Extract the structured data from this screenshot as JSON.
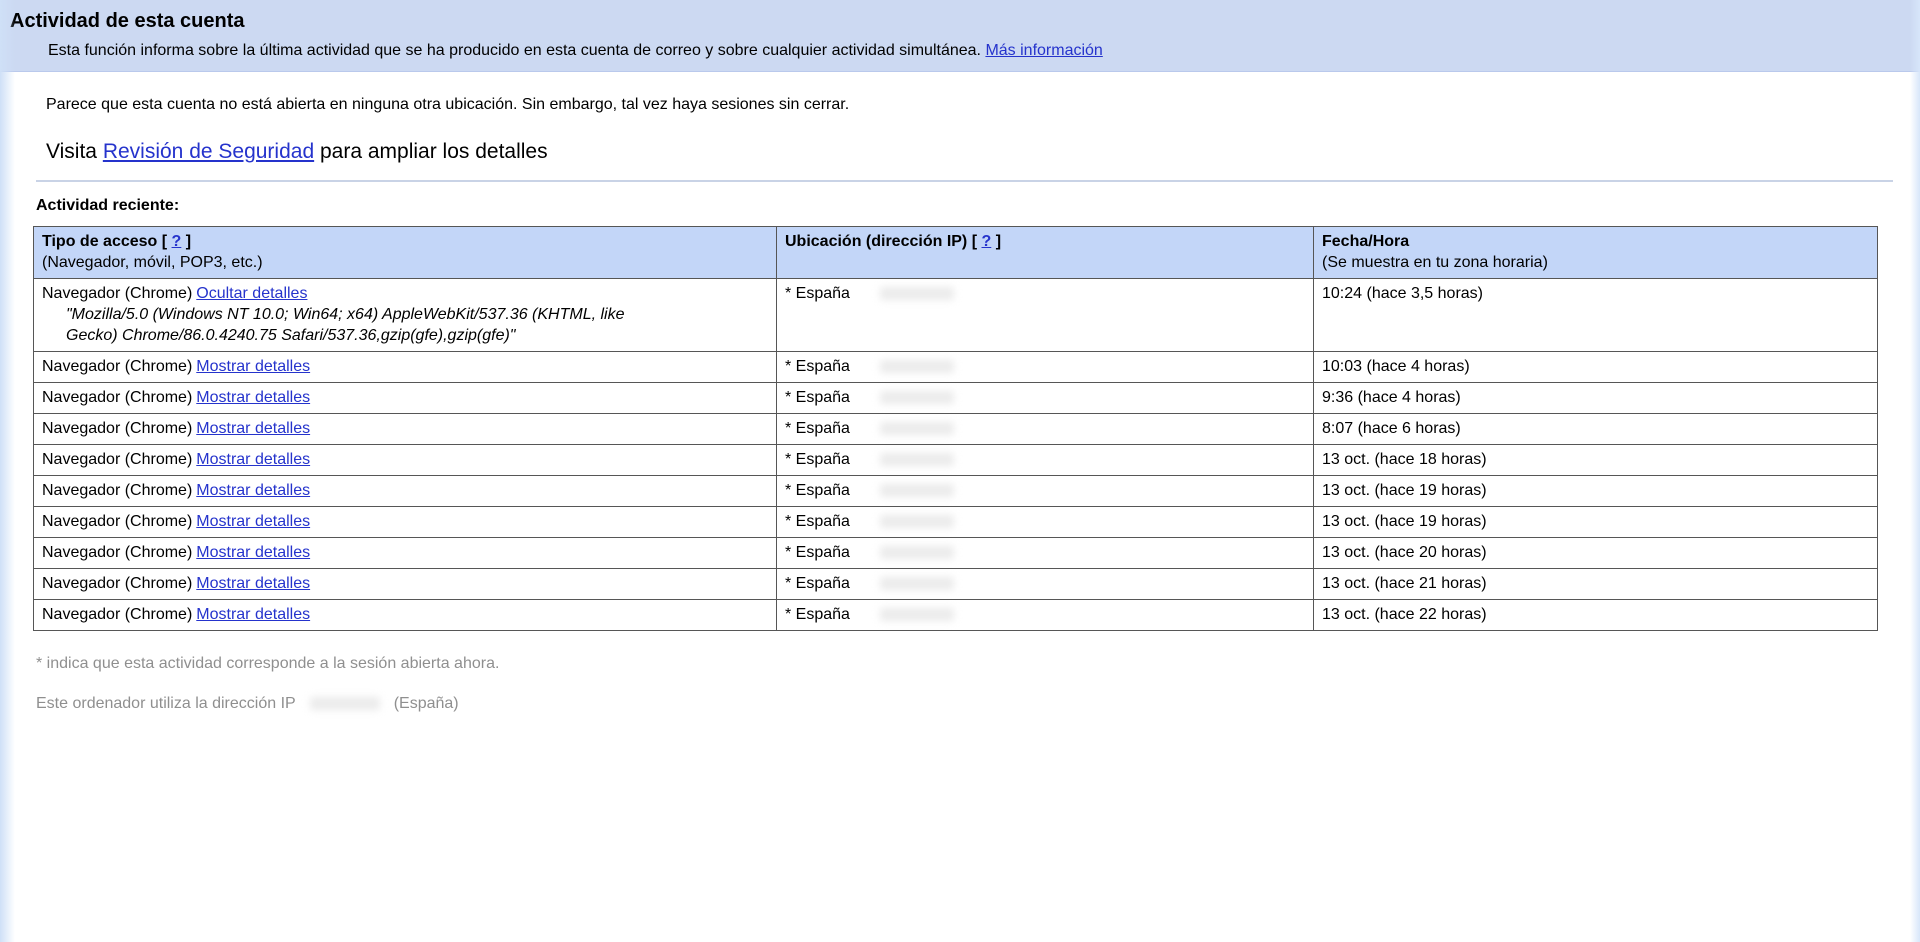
{
  "header": {
    "title": "Actividad de esta cuenta",
    "description": "Esta función informa sobre la última actividad que se ha producido en esta cuenta de correo y sobre cualquier actividad simultánea.",
    "more_info_label": "Más información"
  },
  "status_message": "Parece que esta cuenta no está abierta en ninguna otra ubicación. Sin embargo, tal vez haya sesiones sin cerrar.",
  "security_review": {
    "prefix": "Visita",
    "link_label": "Revisión de Seguridad",
    "suffix": "para ampliar los detalles"
  },
  "recent_activity_label": "Actividad reciente:",
  "table": {
    "help_bracket_open": "[",
    "help_label": "?",
    "help_bracket_close": "]",
    "header": {
      "access": {
        "title": "Tipo de acceso",
        "subtitle": "(Navegador, móvil, POP3, etc.)"
      },
      "location": {
        "title": "Ubicación (dirección IP)",
        "subtitle": ""
      },
      "datetime": {
        "title": "Fecha/Hora",
        "subtitle": "(Se muestra en tu zona horaria)"
      }
    },
    "rows": [
      {
        "access": "Navegador (Chrome)",
        "details_link": "Ocultar detalles",
        "user_agent": "\"Mozilla/5.0 (Windows NT 10.0; Win64; x64) AppleWebKit/537.36 (KHTML, like Gecko) Chrome/86.0.4240.75 Safari/537.36,gzip(gfe),gzip(gfe)\"",
        "location": "* España",
        "datetime": "10:24 (hace 3,5 horas)"
      },
      {
        "access": "Navegador (Chrome)",
        "details_link": "Mostrar detalles",
        "location": "* España",
        "datetime": "10:03 (hace 4 horas)"
      },
      {
        "access": "Navegador (Chrome)",
        "details_link": "Mostrar detalles",
        "location": "* España",
        "datetime": "9:36 (hace 4 horas)"
      },
      {
        "access": "Navegador (Chrome)",
        "details_link": "Mostrar detalles",
        "location": "* España",
        "datetime": "8:07 (hace 6 horas)"
      },
      {
        "access": "Navegador (Chrome)",
        "details_link": "Mostrar detalles",
        "location": "* España",
        "datetime": "13 oct. (hace 18 horas)"
      },
      {
        "access": "Navegador (Chrome)",
        "details_link": "Mostrar detalles",
        "location": "* España",
        "datetime": "13 oct. (hace 19 horas)"
      },
      {
        "access": "Navegador (Chrome)",
        "details_link": "Mostrar detalles",
        "location": "* España",
        "datetime": "13 oct. (hace 19 horas)"
      },
      {
        "access": "Navegador (Chrome)",
        "details_link": "Mostrar detalles",
        "location": "* España",
        "datetime": "13 oct. (hace 20 horas)"
      },
      {
        "access": "Navegador (Chrome)",
        "details_link": "Mostrar detalles",
        "location": "* España",
        "datetime": "13 oct. (hace 21 horas)"
      },
      {
        "access": "Navegador (Chrome)",
        "details_link": "Mostrar detalles",
        "location": "* España",
        "datetime": "13 oct. (hace 22 horas)"
      }
    ]
  },
  "footnotes": {
    "asterisk_note": "* indica que esta actividad corresponde a la sesión abierta ahora.",
    "ip_line_prefix": "Este ordenador utiliza la dirección IP",
    "ip_line_suffix": "(España)"
  },
  "colors": {
    "band_background": "#ccd9f2",
    "table_header_background": "#c3d6f8",
    "link_blue": "#2533cc",
    "table_border": "#565656",
    "footnote_gray": "#8f8f8f"
  }
}
